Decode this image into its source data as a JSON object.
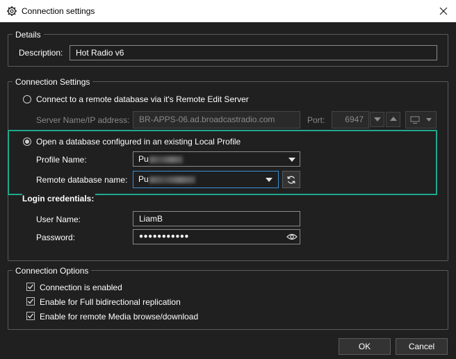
{
  "window": {
    "title": "Connection settings"
  },
  "details": {
    "legend": "Details",
    "description_label": "Description:",
    "description_value": "Hot Radio v6"
  },
  "connection_settings": {
    "legend": "Connection Settings",
    "remote_option_label": "Connect to a remote database via it's Remote Edit Server",
    "server_label": "Server Name/IP address:",
    "server_value": "BR-APPS-06.ad.broadcastradio.com",
    "port_label": "Port:",
    "port_value": "6947",
    "local_option_label": "Open a database configured in an existing Local Profile",
    "profile_label": "Profile Name:",
    "profile_value_prefix": "Pu",
    "remote_db_label": "Remote database name:",
    "remote_db_value_prefix": "Pu",
    "selected_option": "local"
  },
  "login": {
    "legend": "Login credentials:",
    "username_label": "User Name:",
    "username_value": "LiamB",
    "password_label": "Password:",
    "password_value": "●●●●●●●●●●●"
  },
  "connection_options": {
    "legend": "Connection Options",
    "items": [
      {
        "label": "Connection is enabled",
        "checked": true
      },
      {
        "label": "Enable for Full bidirectional replication",
        "checked": true
      },
      {
        "label": "Enable for remote Media browse/download",
        "checked": true
      }
    ]
  },
  "buttons": {
    "ok": "OK",
    "cancel": "Cancel"
  },
  "colors": {
    "highlight": "#21a88e",
    "background": "#202020",
    "focus": "#3a8fd9"
  }
}
